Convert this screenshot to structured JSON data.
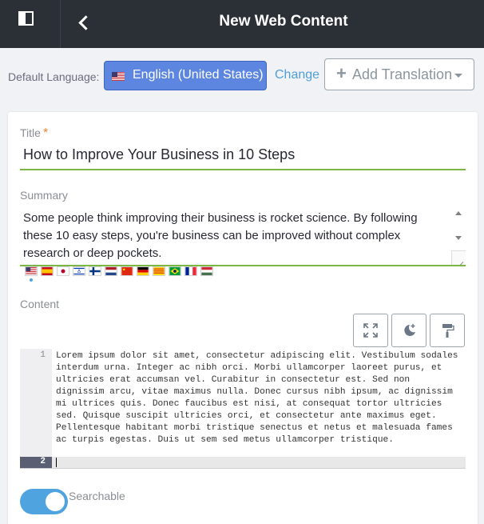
{
  "header": {
    "title": "New Web Content"
  },
  "language": {
    "label": "Default Language:",
    "selected": "English (United States)",
    "change_label": "Change",
    "add_translation_label": "Add Translation"
  },
  "form": {
    "title_label": "Title",
    "title_required_mark": "*",
    "title_value": "How to Improve Your Business in 10 Steps",
    "summary_label": "Summary",
    "summary_value": "Some people think improving their business is rocket science. By following these 10 easy steps, you're business can be improved without complex research or deep pockets.",
    "content_label": "Content",
    "editor": {
      "line1_number": "1",
      "line2_number": "2",
      "line1_text": "Lorem ipsum dolor sit amet, consectetur adipiscing elit. Vestibulum sodales interdum urna. Integer ac nibh orci. Morbi ullamcorper laoreet purus, et ultricies erat accumsan vel. Curabitur in consectetur est. Sed non dignissim arcu, vitae maximus nulla. Donec cursus nibh ipsum, ac dignissim mi ultrices quis. Donec faucibus est nisi, at consequat tortor ultricies sed. Quisque suscipit ultricies orci, et consectetur ante maximus eget. Pellentesque habitant morbi tristique senectus et netus et malesuada fames ac turpis egestas. Duis ut sem sed metus ullamcorper tristique."
    },
    "searchable_label": "Searchable",
    "searchable_on": true
  },
  "translation_flags": [
    "en-US",
    "es-ES",
    "ja-JP",
    "iw-IL",
    "fi-FI",
    "nl-NL",
    "zh-CN",
    "de-DE",
    "ca-ES",
    "pt-BR",
    "fr-FR",
    "hu-HU"
  ],
  "colors": {
    "accent": "#5c86e0",
    "success_underline": "#7cb646",
    "toggle": "#4fa4e0",
    "topbar": "#2b3036"
  }
}
